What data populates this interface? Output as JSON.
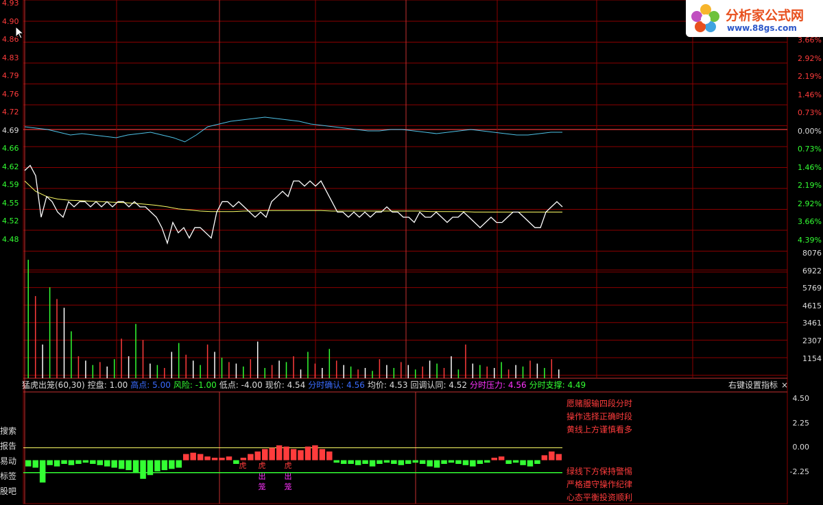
{
  "price_axis": {
    "left_ticks": [
      {
        "v": "4.93",
        "c": "red"
      },
      {
        "v": "4.90",
        "c": "red"
      },
      {
        "v": "4.86",
        "c": "red"
      },
      {
        "v": "4.83",
        "c": "red"
      },
      {
        "v": "4.79",
        "c": "red"
      },
      {
        "v": "4.76",
        "c": "red"
      },
      {
        "v": "4.72",
        "c": "red"
      },
      {
        "v": "4.69",
        "c": "white"
      },
      {
        "v": "4.66",
        "c": "green"
      },
      {
        "v": "4.62",
        "c": "green"
      },
      {
        "v": "4.59",
        "c": "green"
      },
      {
        "v": "4.55",
        "c": "green"
      },
      {
        "v": "4.52",
        "c": "green"
      },
      {
        "v": "4.48",
        "c": "green"
      }
    ],
    "right_ticks": [
      {
        "v": "3.66%",
        "c": "red"
      },
      {
        "v": "2.92%",
        "c": "red"
      },
      {
        "v": "2.19%",
        "c": "red"
      },
      {
        "v": "1.46%",
        "c": "red"
      },
      {
        "v": "0.73%",
        "c": "red"
      },
      {
        "v": "0.00%",
        "c": "white"
      },
      {
        "v": "0.73%",
        "c": "green"
      },
      {
        "v": "1.46%",
        "c": "green"
      },
      {
        "v": "2.19%",
        "c": "green"
      },
      {
        "v": "2.92%",
        "c": "green"
      },
      {
        "v": "3.66%",
        "c": "green"
      },
      {
        "v": "4.39%",
        "c": "green"
      }
    ]
  },
  "volume_axis": {
    "ticks": [
      "8076",
      "6922",
      "5769",
      "4615",
      "3461",
      "2307",
      "1154"
    ]
  },
  "indicator_axis": {
    "ticks": [
      "4.50",
      "2.25",
      "0.00",
      "-2.25"
    ]
  },
  "info_bar": [
    {
      "t": "猛虎出笼(60,30)",
      "c": "#dddddd"
    },
    {
      "t": "控盘: 1.00",
      "c": "#dddddd"
    },
    {
      "t": "高点: 5.00",
      "c": "#3a6cff"
    },
    {
      "t": "风险: -1.00",
      "c": "#33ff33"
    },
    {
      "t": "低点: -4.00",
      "c": "#dddddd"
    },
    {
      "t": "现价: 4.54",
      "c": "#dddddd"
    },
    {
      "t": "分时确认: 4.56",
      "c": "#3a6cff"
    },
    {
      "t": "均价: 4.53",
      "c": "#dddddd"
    },
    {
      "t": "回调认同: 4.52",
      "c": "#dddddd"
    },
    {
      "t": "分时压力: 4.56",
      "c": "#ff33ff"
    },
    {
      "t": "分时支撑: 4.49",
      "c": "#33ff33"
    }
  ],
  "settings_label": "右键设置指标",
  "settings_close": "×",
  "side_menu": [
    "搜索",
    "报告",
    "易动",
    "标签",
    "股吧"
  ],
  "notes_top": [
    "愿赌服输四段分时",
    "操作选择正确时段",
    "黄线上方谨慎看多"
  ],
  "notes_bottom": [
    "绿线下方保持警惕",
    "严格遵守操作纪律",
    "心态平衡投资顺利"
  ],
  "signals": [
    {
      "t": "虎",
      "c": "#ff3c3c"
    },
    {
      "t": "虎",
      "c": "#ff3c3c"
    },
    {
      "t": "出",
      "c": "#ff33ff"
    },
    {
      "t": "笼",
      "c": "#ff33ff"
    },
    {
      "t": "虎",
      "c": "#ff3c3c"
    },
    {
      "t": "出",
      "c": "#ff33ff"
    },
    {
      "t": "笼",
      "c": "#ff33ff"
    }
  ],
  "logo": {
    "name": "分析家公式网",
    "url": "www.88gs.com"
  },
  "colors": {
    "bg": "#000000",
    "grid": "#8b0000",
    "up": "#ff3c3c",
    "down": "#33ff33",
    "price_line": "#ffffff",
    "avg_line": "#ffff66",
    "index_line": "#4fc3e8"
  },
  "chart_data": {
    "type": "line",
    "title": "",
    "xlabel": "",
    "ylabel": "",
    "ylim": [
      4.45,
      4.93
    ],
    "grid": true,
    "price": [
      4.61,
      4.62,
      4.6,
      4.52,
      4.56,
      4.55,
      4.53,
      4.52,
      4.55,
      4.54,
      4.55,
      4.55,
      4.54,
      4.55,
      4.54,
      4.55,
      4.54,
      4.55,
      4.55,
      4.54,
      4.55,
      4.54,
      4.54,
      4.53,
      4.52,
      4.5,
      4.47,
      4.51,
      4.49,
      4.5,
      4.48,
      4.5,
      4.5,
      4.49,
      4.48,
      4.53,
      4.55,
      4.55,
      4.54,
      4.55,
      4.54,
      4.53,
      4.52,
      4.53,
      4.52,
      4.55,
      4.56,
      4.57,
      4.56,
      4.59,
      4.59,
      4.58,
      4.59,
      4.58,
      4.59,
      4.57,
      4.55,
      4.53,
      4.53,
      4.52,
      4.53,
      4.52,
      4.53,
      4.52,
      4.53,
      4.53,
      4.54,
      4.53,
      4.53,
      4.52,
      4.52,
      4.51,
      4.53,
      4.52,
      4.52,
      4.53,
      4.52,
      4.51,
      4.52,
      4.52,
      4.53,
      4.52,
      4.51,
      4.5,
      4.51,
      4.52,
      4.51,
      4.51,
      4.52,
      4.53,
      4.53,
      4.52,
      4.51,
      4.5,
      4.5,
      4.53,
      4.54,
      4.55,
      4.54
    ],
    "avg": [
      4.59,
      4.57,
      4.56,
      4.555,
      4.553,
      4.552,
      4.551,
      4.55,
      4.549,
      4.548,
      4.547,
      4.545,
      4.543,
      4.54,
      4.536,
      4.534,
      4.532,
      4.531,
      4.531,
      4.531,
      4.532,
      4.532,
      4.533,
      4.533,
      4.533,
      4.533,
      4.533,
      4.533,
      4.532,
      4.532,
      4.532,
      4.532,
      4.532,
      4.532,
      4.532,
      4.532,
      4.532,
      4.531,
      4.531,
      4.531,
      4.531,
      4.53,
      4.53,
      4.53,
      4.53,
      4.53,
      4.53,
      4.53,
      4.53,
      4.53
    ],
    "index_pct": [
      0.1,
      0.05,
      0.0,
      -0.1,
      -0.2,
      -0.15,
      -0.2,
      -0.25,
      -0.3,
      -0.2,
      -0.15,
      -0.1,
      -0.2,
      -0.3,
      -0.45,
      -0.2,
      0.1,
      0.2,
      0.3,
      0.35,
      0.4,
      0.45,
      0.4,
      0.35,
      0.3,
      0.2,
      0.15,
      0.1,
      0.05,
      0.0,
      -0.05,
      -0.05,
      0.0,
      0.0,
      -0.05,
      -0.1,
      -0.15,
      -0.1,
      -0.05,
      0.0,
      -0.05,
      -0.1,
      -0.15,
      -0.2,
      -0.2,
      -0.15,
      -0.1,
      -0.1
    ],
    "volume": [
      8076,
      5600,
      2300,
      6200,
      5400,
      4800,
      3200,
      1500,
      1200,
      900,
      1100,
      800,
      1300,
      2700,
      1500,
      3700,
      2600,
      1000,
      900,
      700,
      1800,
      2400,
      1600,
      1200,
      900,
      2300,
      1800,
      1400,
      1100,
      1000,
      800,
      1300,
      2500,
      700,
      900,
      1200,
      1100,
      1500,
      600,
      1800,
      1000,
      700,
      2000,
      1200,
      900,
      800,
      600,
      700,
      500,
      1300,
      900,
      700,
      1100,
      900,
      600,
      800,
      1200,
      1000,
      700,
      1500,
      600,
      2300,
      1000,
      900,
      800,
      700,
      1100,
      600,
      900,
      800,
      1200,
      1000,
      700,
      1300,
      600
    ],
    "volume_ylim": [
      0,
      8500
    ],
    "indicator": [
      -0.5,
      -0.6,
      -1.8,
      -0.4,
      -0.5,
      -0.3,
      -0.4,
      -0.3,
      -0.2,
      -0.3,
      -0.4,
      -0.5,
      -0.6,
      -0.7,
      -0.8,
      -1.0,
      -1.5,
      -1.2,
      -0.9,
      -0.8,
      -0.7,
      -0.6,
      0.5,
      0.6,
      0.5,
      0.3,
      0.2,
      0.2,
      0.3,
      -0.3,
      0.2,
      0.5,
      0.7,
      0.9,
      1.0,
      1.2,
      1.1,
      0.9,
      0.8,
      1.1,
      1.2,
      0.9,
      0.7,
      -0.2,
      -0.3,
      -0.3,
      -0.4,
      -0.3,
      -0.5,
      -0.3,
      -0.2,
      -0.3,
      -0.4,
      -0.3,
      -0.2,
      -0.3,
      -0.5,
      -0.6,
      -0.3,
      -0.2,
      -0.3,
      -0.4,
      -0.5,
      -0.3,
      -0.2,
      0.2,
      0.3,
      -0.3,
      -0.2,
      -0.4,
      -0.5,
      -0.3,
      0.4,
      0.7,
      0.5
    ],
    "indicator_ylim": [
      -3.5,
      5.5
    ],
    "yellow_level": 1.0,
    "green_level": -1.0
  }
}
